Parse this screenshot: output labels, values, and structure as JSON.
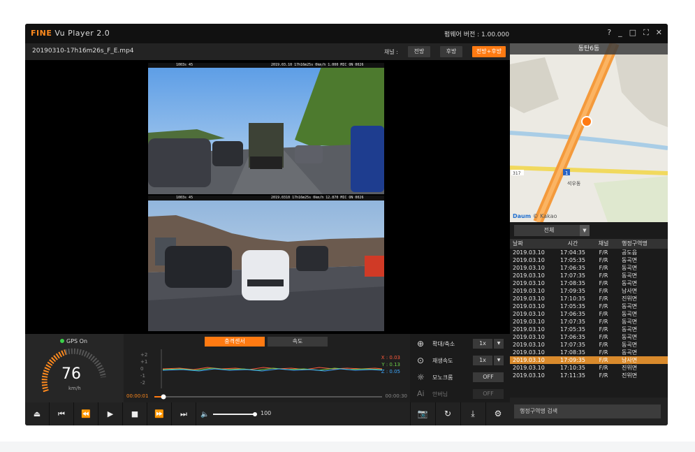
{
  "window": {
    "app_name_brand": "FINE",
    "app_name_rest": " Vu Player 2.0",
    "firmware_version": "펌웨어 버전 : 1.00.000",
    "controls": [
      "?",
      "_",
      "□",
      "⛶",
      "✕"
    ]
  },
  "file": {
    "name": "20190310-17h16m26s_F_E.mp4",
    "channel_label": "채널 :",
    "channel_buttons": [
      "전방",
      "후방",
      "전방+후방"
    ],
    "active_channel": "전방+후방"
  },
  "video": {
    "front_overlay_left": "1003s 45",
    "front_overlay_right": "2019.03.10 17h16m25s 0km/h 1.000 MIC ON 0026",
    "rear_overlay_left": "1003s 45",
    "rear_overlay_right": "2019.0310 17h16m25s 0km/h 12.870 MIC ON 0026"
  },
  "map": {
    "title": "동탄6동",
    "road_label_1": "317",
    "road_label_2": "1",
    "place_label": "석우동",
    "credit_brand": "Daum",
    "credit_rest": "© Kakao"
  },
  "log": {
    "filter": "전체",
    "columns": [
      "날짜",
      "시간",
      "채널",
      "행정구역명"
    ],
    "rows": [
      [
        "2019.03.10",
        "17:04:35",
        "F/R",
        "공도읍"
      ],
      [
        "2019.03.10",
        "17:05:35",
        "F/R",
        "동곡면"
      ],
      [
        "2019.03.10",
        "17:06:35",
        "F/R",
        "동곡면"
      ],
      [
        "2019.03.10",
        "17:07:35",
        "F/R",
        "동곡면"
      ],
      [
        "2019.03.10",
        "17:08:35",
        "F/R",
        "동곡면"
      ],
      [
        "2019.03.10",
        "17:09:35",
        "F/R",
        "남사면"
      ],
      [
        "2019.03.10",
        "17:10:35",
        "F/R",
        "진위면"
      ],
      [
        "2019.03.10",
        "17:05:35",
        "F/R",
        "동곡면"
      ],
      [
        "2019.03.10",
        "17:06:35",
        "F/R",
        "동곡면"
      ],
      [
        "2019.03.10",
        "17:07:35",
        "F/R",
        "동곡면"
      ],
      [
        "2019.03.10",
        "17:05:35",
        "F/R",
        "동곡면"
      ],
      [
        "2019.03.10",
        "17:06:35",
        "F/R",
        "동곡면"
      ],
      [
        "2019.03.10",
        "17:07:35",
        "F/R",
        "동곡면"
      ],
      [
        "2019.03.10",
        "17:08:35",
        "F/R",
        "동곡면"
      ],
      [
        "2019.03.10",
        "17:09:35",
        "F/R",
        "남사면"
      ],
      [
        "2019.03.10",
        "17:10:35",
        "F/R",
        "진위면"
      ],
      [
        "2019.03.10",
        "17:11:35",
        "F/R",
        "진위면"
      ]
    ],
    "selected_index": 14,
    "search_placeholder": "행정구역명 검색"
  },
  "gauge": {
    "gps_status": "GPS On",
    "speed": "76",
    "unit": "km/h",
    "accent": "#ff8a1e"
  },
  "graph": {
    "tabs": [
      "충격센서",
      "속도"
    ],
    "active_tab": "충격센서",
    "y_labels": [
      "+2",
      "+1",
      "0",
      "-1",
      "-2"
    ],
    "x_value": "X : 0.03",
    "y_value": "Y : 0.13",
    "z_value": "Z : 0.05",
    "time_start": "00:00:01",
    "time_end": "00:00:30",
    "playback_progress": 0.04
  },
  "settings": {
    "zoom_label": "확대/축소",
    "zoom_value": "1x",
    "speed_label": "재생속도",
    "speed_value": "1x",
    "mono_label": "모노크롬",
    "mono_value": "OFF",
    "ai_icon": "Ai",
    "ai_label": "안버님",
    "ai_value": "OFF"
  },
  "playback": {
    "volume": "100",
    "volume_level": 1.0
  },
  "colors": {
    "accent": "#ff7a12",
    "selected_row": "#d98a2c",
    "x_axis": "#ff5a3c",
    "y_axis": "#6cd04a",
    "z_axis": "#3ca8ff"
  }
}
